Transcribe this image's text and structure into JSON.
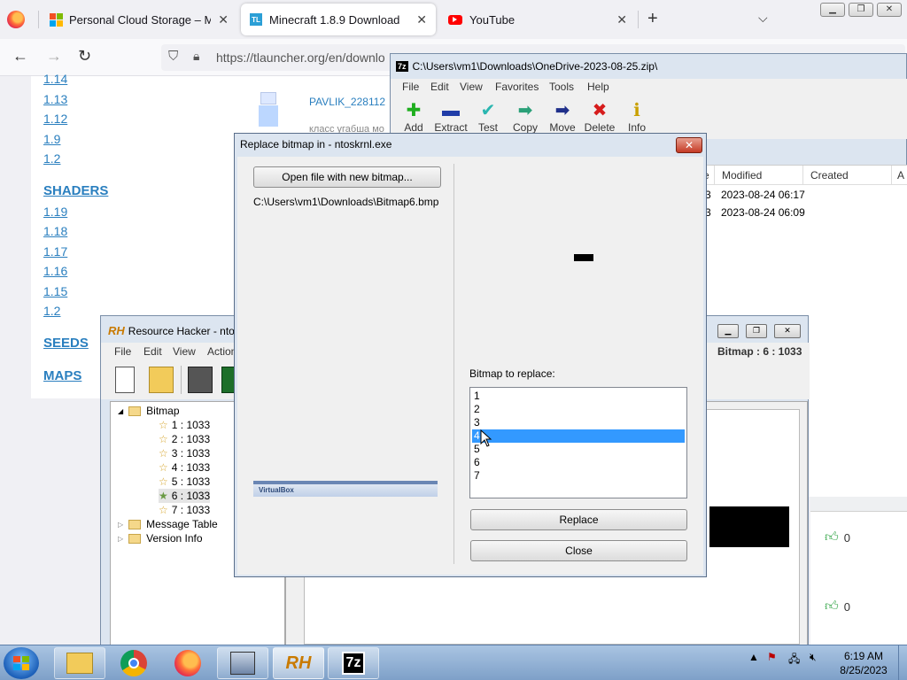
{
  "browser": {
    "tabs": [
      {
        "title": "Personal Cloud Storage – Micro",
        "icon": "microsoft-icon"
      },
      {
        "title": "Minecraft 1.8.9 Download",
        "icon": "tlauncher-icon",
        "active": true
      },
      {
        "title": "YouTube",
        "icon": "youtube-icon"
      }
    ],
    "url": "https://tlauncher.org/en/downlo"
  },
  "webpage": {
    "versions_top": [
      "1.14",
      "1.13",
      "1.12",
      "1.9",
      "1.2"
    ],
    "shaders_heading": "SHADERS",
    "versions_shaders": [
      "1.19",
      "1.18",
      "1.17",
      "1.16",
      "1.15",
      "1.2"
    ],
    "seeds_heading": "SEEDS",
    "maps_heading": "MAPS",
    "comment_author": "PAVLIK_228112",
    "comment_text": "класс угабша мо",
    "likes": [
      "0",
      "0"
    ]
  },
  "zip": {
    "title": "C:\\Users\\vm1\\Downloads\\OneDrive-2023-08-25.zip\\",
    "menu": [
      "File",
      "Edit",
      "View",
      "Favorites",
      "Tools",
      "Help"
    ],
    "tools": [
      "Add",
      "Extract",
      "Test",
      "Copy",
      "Move",
      "Delete",
      "Info"
    ],
    "columns": [
      "e",
      "Modified",
      "Created",
      "A"
    ],
    "rows": [
      {
        "c1": "3",
        "modified": "2023-08-24 06:17"
      },
      {
        "c1": "3",
        "modified": "2023-08-24 06:09"
      }
    ]
  },
  "rh": {
    "title": "Resource Hacker - ntos",
    "menu": [
      "File",
      "Edit",
      "View",
      "Action"
    ],
    "status": "Bitmap : 6 : 1033",
    "tree": {
      "root": "Bitmap",
      "items": [
        "1 : 1033",
        "2 : 1033",
        "3 : 1033",
        "4 : 1033",
        "5 : 1033",
        "6 : 1033",
        "7 : 1033"
      ],
      "others": [
        "Message Table",
        "Version Info"
      ]
    }
  },
  "dialog": {
    "title": "Replace bitmap in - ntoskrnl.exe",
    "open_button": "Open file with new bitmap...",
    "path": "C:\\Users\\vm1\\Downloads\\Bitmap6.bmp",
    "preview_label": "VirtualBox",
    "list_label": "Bitmap to replace:",
    "list_items": [
      "1",
      "2",
      "3",
      "4",
      "5",
      "6",
      "7"
    ],
    "selected_index": 3,
    "replace_button": "Replace",
    "close_button": "Close"
  },
  "taskbar": {
    "time": "6:19 AM",
    "date": "8/25/2023"
  }
}
